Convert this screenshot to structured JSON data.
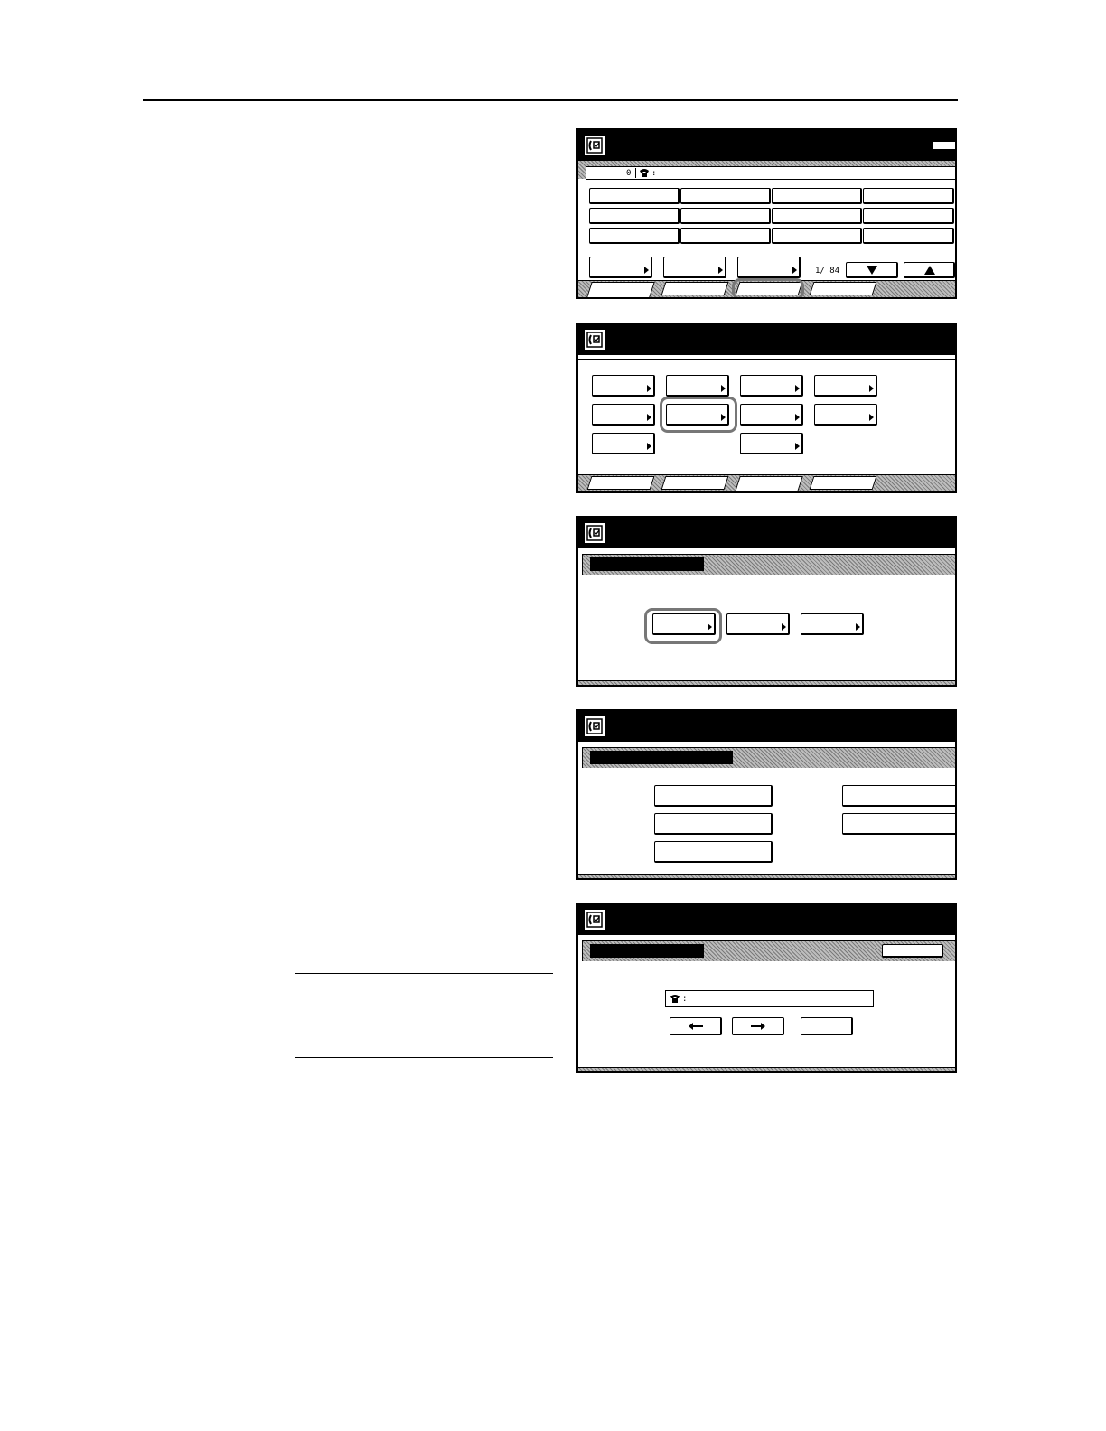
{
  "screens": [
    {
      "id": "destination-screen",
      "field_count": "0",
      "phone_prefix": ":",
      "page_indicator": "1/ 84",
      "icons": [
        "fax-icon",
        "phone-icon",
        "arrow-down-icon",
        "arrow-up-icon"
      ]
    },
    {
      "id": "function-menu-screen",
      "icons": [
        "fax-icon"
      ]
    },
    {
      "id": "sub-option-screen",
      "icons": [
        "fax-icon"
      ]
    },
    {
      "id": "settings-screen",
      "icons": [
        "fax-icon"
      ]
    },
    {
      "id": "number-entry-screen",
      "phone_prefix": ":",
      "icons": [
        "fax-icon",
        "phone-icon",
        "arrow-left-icon",
        "arrow-right-icon"
      ]
    }
  ],
  "colors": {
    "highlight": "#777777",
    "titlebar": "#000000"
  }
}
